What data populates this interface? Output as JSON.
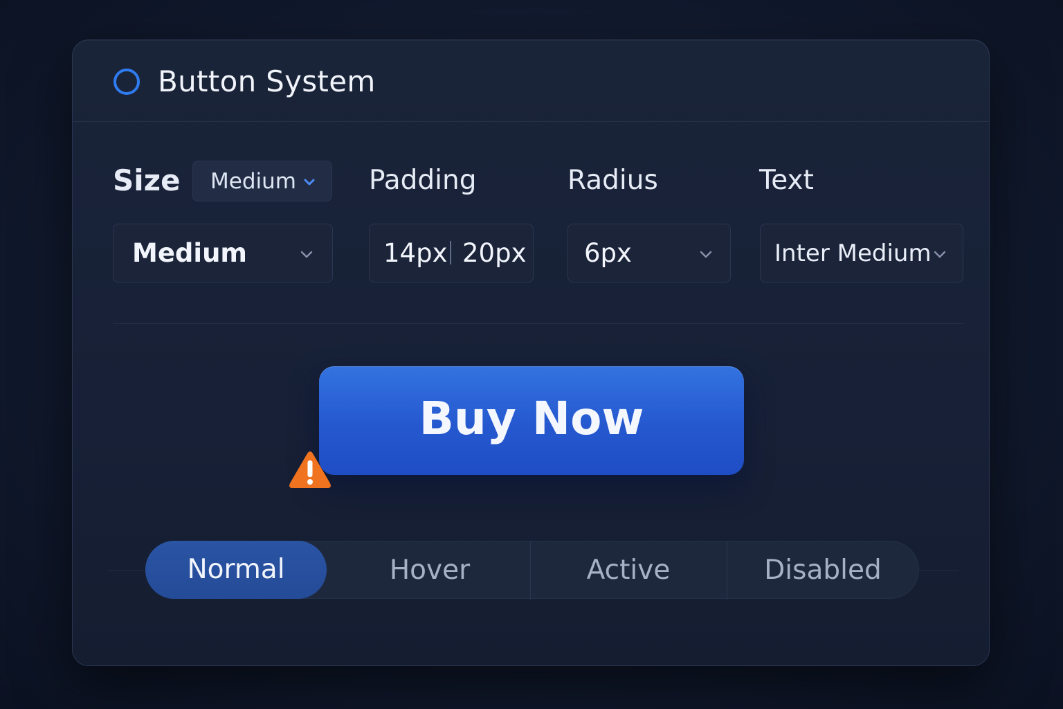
{
  "header": {
    "title": "Button System",
    "icon": "ring-icon",
    "icon_color": "#2f7bf0"
  },
  "controls": {
    "size": {
      "label": "Size",
      "mini_value": "Medium",
      "value": "Medium"
    },
    "padding": {
      "label": "Padding",
      "vertical": "14px",
      "horizontal": "20px"
    },
    "radius": {
      "label": "Radius",
      "value": "6px"
    },
    "text": {
      "label": "Text",
      "value": "Inter Medium"
    }
  },
  "preview": {
    "button_label": "Buy Now",
    "button_color": "#2a62d8",
    "warning_icon": "warning-triangle-icon",
    "warning_color": "#f0731f"
  },
  "states": {
    "tabs": [
      {
        "label": "Normal",
        "selected": true
      },
      {
        "label": "Hover",
        "selected": false
      },
      {
        "label": "Active",
        "selected": false
      },
      {
        "label": "Disabled",
        "selected": false
      }
    ]
  }
}
